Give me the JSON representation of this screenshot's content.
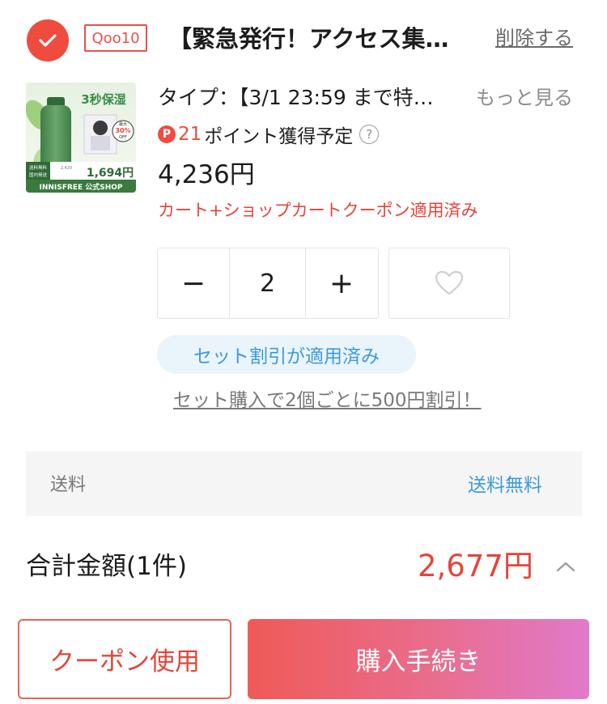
{
  "shop": {
    "badge": "Qoo10",
    "name": "【緊急発行！アクセス集…",
    "delete_label": "削除する"
  },
  "product": {
    "type_line": "タイプ：【3/1 23:59 まで特…",
    "more_label": "もっと見る",
    "points_icon": "P",
    "points_value": "21",
    "points_text": "ポイント獲得予定",
    "help_icon": "?",
    "price": "4,236円",
    "coupon_applied": "カート+ショップカートクーポン適用済み",
    "image": {
      "headline": "3秒保湿",
      "discount_top": "最大",
      "discount_value": "30%",
      "discount_bottom": "OFF",
      "left_tag_1": "送料無料",
      "left_tag_2": "国内発送",
      "small_price": "2,420",
      "big_price": "1,694円",
      "brand": "INNISFREE 公式SHOP"
    }
  },
  "quantity": {
    "minus": "−",
    "value": "2",
    "plus": "+"
  },
  "set_discount": {
    "pill": "セット割引が適用済み",
    "link": "セット購入で2個ごとに500円割引！"
  },
  "shipping": {
    "label": "送料",
    "value": "送料無料"
  },
  "total": {
    "label": "合計金額(1件)",
    "value": "2,677円"
  },
  "buttons": {
    "coupon": "クーポン使用",
    "checkout": "購入手続き"
  },
  "colors": {
    "accent": "#ef4b3f",
    "link_blue": "#3e9ad8",
    "gradient_start": "#ef5a57",
    "gradient_end": "#e17acb"
  }
}
